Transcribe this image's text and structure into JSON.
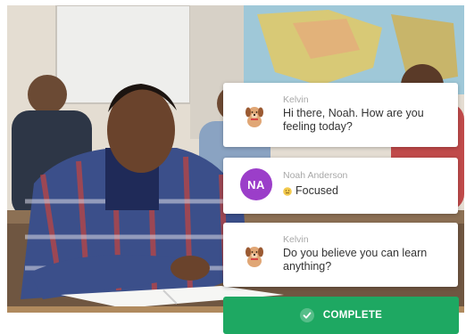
{
  "messages": [
    {
      "sender": "Kelvin",
      "avatar": "dog-mascot-icon",
      "text": "Hi there, Noah. How are you feeling today?"
    },
    {
      "sender": "Noah Anderson",
      "avatar_initials": "NA",
      "avatar_color": "#9b3ec9",
      "emoji": "neutral-face-emoji",
      "text": "Focused"
    },
    {
      "sender": "Kelvin",
      "avatar": "dog-mascot-icon",
      "text": "Do you believe you can learn anything?"
    }
  ],
  "complete_button": {
    "label": "COMPLETE",
    "icon": "check-icon",
    "color": "#1ea862"
  }
}
